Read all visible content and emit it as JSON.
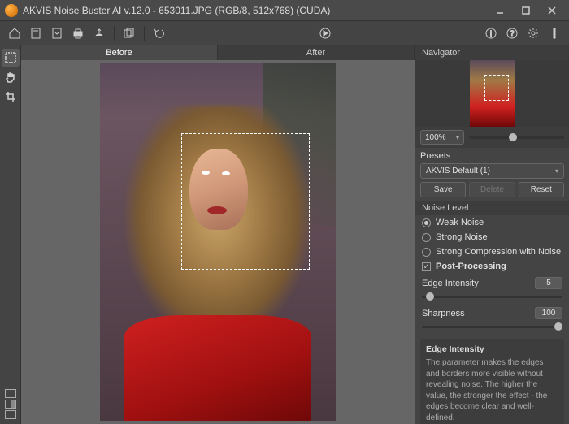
{
  "window": {
    "title": "AKVIS Noise Buster AI v.12.0 - 653011.JPG (RGB/8, 512x768) (CUDA)"
  },
  "tabs": {
    "before": "Before",
    "after": "After"
  },
  "navigator": {
    "label": "Navigator",
    "zoom": "100%"
  },
  "presets": {
    "label": "Presets",
    "selected": "AKVIS Default (1)",
    "save": "Save",
    "delete": "Delete",
    "reset": "Reset"
  },
  "noise": {
    "heading": "Noise Level",
    "weak": "Weak Noise",
    "strong": "Strong Noise",
    "compression": "Strong Compression with Noise",
    "post": "Post-Processing"
  },
  "params": {
    "edge_label": "Edge Intensity",
    "edge_value": "5",
    "sharp_label": "Sharpness",
    "sharp_value": "100"
  },
  "help": {
    "title": "Edge Intensity",
    "body": "The parameter makes the edges and borders more visible without revealing noise. The higher the value, the stronger the effect - the edges become clear and well-defined."
  }
}
